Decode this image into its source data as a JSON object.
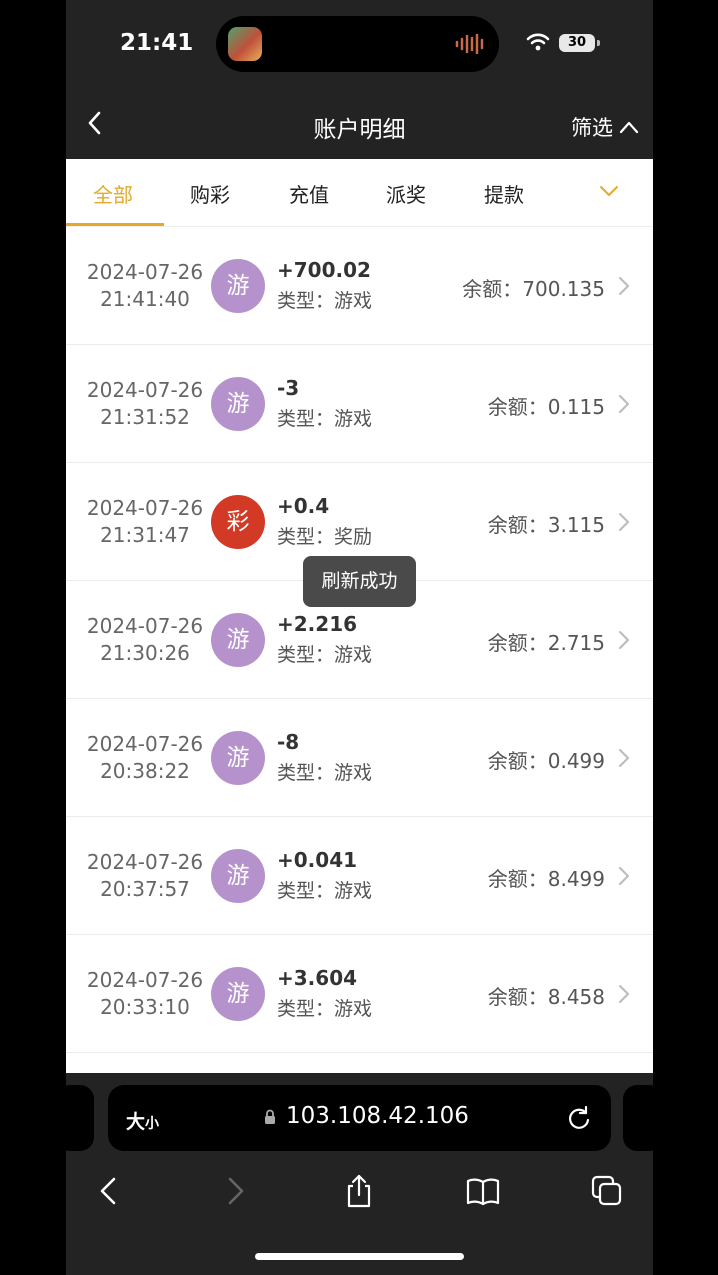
{
  "status": {
    "time": "21:41",
    "battery": "30"
  },
  "header": {
    "title": "账户明细",
    "filter_label": "筛选"
  },
  "tabs": [
    {
      "label": "全部",
      "active": true
    },
    {
      "label": "购彩"
    },
    {
      "label": "充值"
    },
    {
      "label": "派奖"
    },
    {
      "label": "提款"
    }
  ],
  "records": [
    {
      "date": "2024-07-26",
      "time": "21:41:40",
      "badge": "游",
      "amount": "+700.02",
      "type": "类型：游戏",
      "balance": "余额：700.135"
    },
    {
      "date": "2024-07-26",
      "time": "21:31:52",
      "badge": "游",
      "amount": "-3",
      "type": "类型：游戏",
      "balance": "余额：0.115"
    },
    {
      "date": "2024-07-26",
      "time": "21:31:47",
      "badge": "彩",
      "amount": "+0.4",
      "type": "类型：奖励",
      "balance": "余额：3.115"
    },
    {
      "date": "2024-07-26",
      "time": "21:30:26",
      "badge": "游",
      "amount": "+2.216",
      "type": "类型：游戏",
      "balance": "余额：2.715"
    },
    {
      "date": "2024-07-26",
      "time": "20:38:22",
      "badge": "游",
      "amount": "-8",
      "type": "类型：游戏",
      "balance": "余额：0.499"
    },
    {
      "date": "2024-07-26",
      "time": "20:37:57",
      "badge": "游",
      "amount": "+0.041",
      "type": "类型：游戏",
      "balance": "余额：8.499"
    },
    {
      "date": "2024-07-26",
      "time": "20:33:10",
      "badge": "游",
      "amount": "+3.604",
      "type": "类型：游戏",
      "balance": "余额：8.458"
    }
  ],
  "toast": "刷新成功",
  "browser": {
    "text_size_big": "大",
    "text_size_small": "小",
    "url": "103.108.42.106"
  },
  "colors": {
    "accent": "#e5a92a",
    "game_badge": "#b592cc",
    "lottery_badge": "#d33a25",
    "header_bg": "#232323"
  }
}
